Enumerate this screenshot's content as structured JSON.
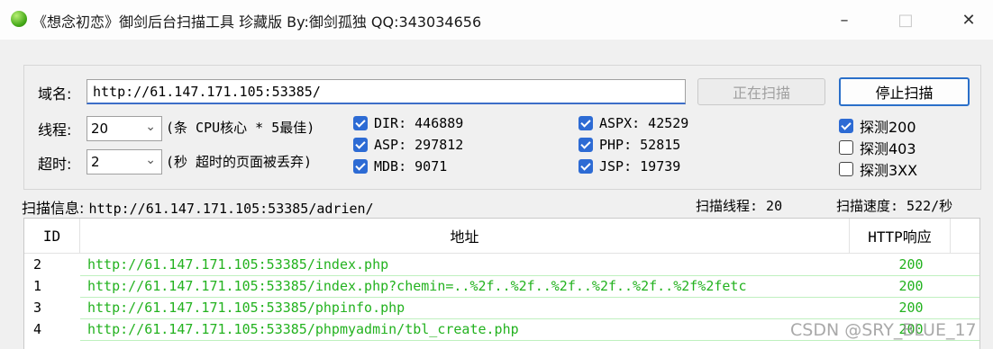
{
  "window": {
    "title": "《想念初恋》御剑后台扫描工具 珍藏版 By:御剑孤独 QQ:343034656",
    "minimize_icon": "minimize-icon",
    "maximize_icon": "maximize-icon",
    "close_icon": "close-icon"
  },
  "form": {
    "domain_label": "域名:",
    "domain_value": "http://61.147.171.105:53385/",
    "threads_label": "线程:",
    "threads_value": "20",
    "threads_hint": "(条 CPU核心 * 5最佳)",
    "timeout_label": "超时:",
    "timeout_value": "2",
    "timeout_hint": "(秒 超时的页面被丢弃)",
    "scanning_button": "正在扫描",
    "stop_button": "停止扫描"
  },
  "dictionaries": [
    {
      "label": "DIR: 446889",
      "checked": true
    },
    {
      "label": "ASP: 297812",
      "checked": true
    },
    {
      "label": "MDB: 9071",
      "checked": true
    },
    {
      "label": "ASPX: 42529",
      "checked": true
    },
    {
      "label": "PHP: 52815",
      "checked": true
    },
    {
      "label": "JSP: 19739",
      "checked": true
    }
  ],
  "probes": [
    {
      "label": "探测200",
      "checked": true
    },
    {
      "label": "探测403",
      "checked": false
    },
    {
      "label": "探测3XX",
      "checked": false
    }
  ],
  "status": {
    "info_label": "扫描信息:",
    "info_value": "http://61.147.171.105:53385/adrien/",
    "threads": "扫描线程: 20",
    "speed": "扫描速度: 522/秒"
  },
  "table": {
    "columns": [
      "ID",
      "地址",
      "HTTP响应"
    ],
    "rows": [
      {
        "id": "2",
        "address": "http://61.147.171.105:53385/index.php",
        "code": "200"
      },
      {
        "id": "1",
        "address": "http://61.147.171.105:53385/index.php?chemin=..%2f..%2f..%2f..%2f..%2f..%2f%2fetc",
        "code": "200"
      },
      {
        "id": "3",
        "address": "http://61.147.171.105:53385/phpinfo.php",
        "code": "200"
      },
      {
        "id": "4",
        "address": "http://61.147.171.105:53385/phpmyadmin/tbl_create.php",
        "code": "200"
      }
    ]
  },
  "watermark": "CSDN @SRY_BLUE_17",
  "colors": {
    "accent": "#2d6bd4",
    "found": "#23b21f"
  }
}
